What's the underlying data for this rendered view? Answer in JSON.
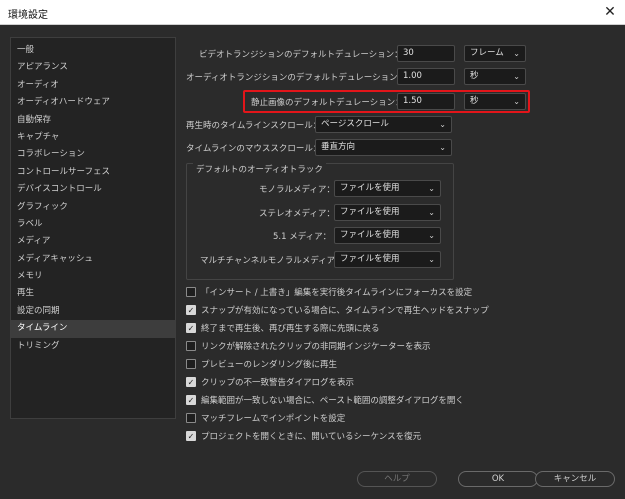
{
  "window": {
    "title": "環境設定",
    "close_glyph": "✕"
  },
  "sidebar": {
    "items": [
      {
        "label": "一般"
      },
      {
        "label": "アピアランス"
      },
      {
        "label": "オーディオ"
      },
      {
        "label": "オーディオハードウェア"
      },
      {
        "label": "自動保存"
      },
      {
        "label": "キャプチャ"
      },
      {
        "label": "コラボレーション"
      },
      {
        "label": "コントロールサーフェス"
      },
      {
        "label": "デバイスコントロール"
      },
      {
        "label": "グラフィック"
      },
      {
        "label": "ラベル"
      },
      {
        "label": "メディア"
      },
      {
        "label": "メディアキャッシュ"
      },
      {
        "label": "メモリ"
      },
      {
        "label": "再生"
      },
      {
        "label": "設定の同期"
      },
      {
        "label": "タイムライン",
        "selected": true
      },
      {
        "label": "トリミング"
      }
    ]
  },
  "durations": [
    {
      "label": "ビデオトランジションのデフォルトデュレーション：",
      "value": "30",
      "unit": "フレーム"
    },
    {
      "label": "オーディオトランジションのデフォルトデュレーション：",
      "value": "1.00",
      "unit": "秒"
    },
    {
      "label": "静止画像のデフォルトデュレーション：",
      "value": "1.50",
      "unit": "秒"
    }
  ],
  "scroll": {
    "playback_label": "再生時のタイムラインスクロール：",
    "playback_value": "ページスクロール",
    "mouse_label": "タイムラインのマウススクロール：",
    "mouse_value": "垂直方向"
  },
  "audio_tracks": {
    "group_title": "デフォルトのオーディオトラック",
    "rows": [
      {
        "label": "モノラルメディア：",
        "value": "ファイルを使用"
      },
      {
        "label": "ステレオメディア：",
        "value": "ファイルを使用"
      },
      {
        "label": "5.1 メディア：",
        "value": "ファイルを使用"
      },
      {
        "label": "マルチチャンネルモノラルメディア：",
        "value": "ファイルを使用"
      }
    ]
  },
  "checks": [
    {
      "label": "「インサート / 上書き」編集を実行後タイムラインにフォーカスを設定",
      "checked": false
    },
    {
      "label": "スナップが有効になっている場合に、タイムラインで再生ヘッドをスナップ",
      "checked": true
    },
    {
      "label": "終了まで再生後、再び再生する際に先頭に戻る",
      "checked": true
    },
    {
      "label": "リンクが解除されたクリップの非同期インジケーターを表示",
      "checked": false
    },
    {
      "label": "プレビューのレンダリング後に再生",
      "checked": false
    },
    {
      "label": "クリップの不一致警告ダイアログを表示",
      "checked": true
    },
    {
      "label": "編集範囲が一致しない場合に、ペースト範囲の調整ダイアログを開く",
      "checked": true
    },
    {
      "label": "マッチフレームでインポイントを設定",
      "checked": false
    },
    {
      "label": "プロジェクトを開くときに、開いているシーケンスを復元",
      "checked": true
    }
  ],
  "buttons": {
    "help": "ヘルプ",
    "ok": "OK",
    "cancel": "キャンセル"
  },
  "icons": {
    "chevron": "chevron-down-icon",
    "check": "checkmark-icon"
  },
  "colors": {
    "highlight": "#e3151a",
    "background": "#2b2b2b"
  }
}
